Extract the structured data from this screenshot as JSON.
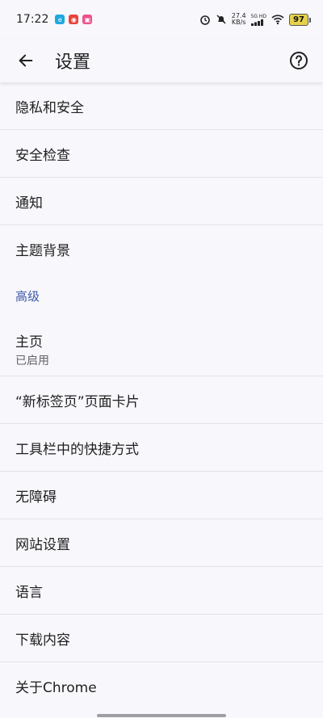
{
  "status_bar": {
    "time": "17:22",
    "net_speed_value": "27.4",
    "net_speed_unit": "KB/s",
    "network_top": "5G HD",
    "network_bottom": "",
    "battery": "97"
  },
  "header": {
    "title": "设置"
  },
  "settings": {
    "items_top": [
      {
        "label": "隐私和安全"
      },
      {
        "label": "安全检查"
      },
      {
        "label": "通知"
      },
      {
        "label": "主题背景"
      }
    ],
    "advanced_header": "高级",
    "homepage": {
      "label": "主页",
      "sub": "已启用"
    },
    "items_bottom": [
      {
        "label": "“新标签页”页面卡片"
      },
      {
        "label": "工具栏中的快捷方式"
      },
      {
        "label": "无障碍"
      },
      {
        "label": "网站设置"
      },
      {
        "label": "语言"
      },
      {
        "label": "下载内容"
      },
      {
        "label": "关于Chrome"
      }
    ]
  },
  "colors": {
    "accent": "#3d5aa8",
    "background": "#f8f7fc",
    "divider": "#e3e2e7"
  }
}
